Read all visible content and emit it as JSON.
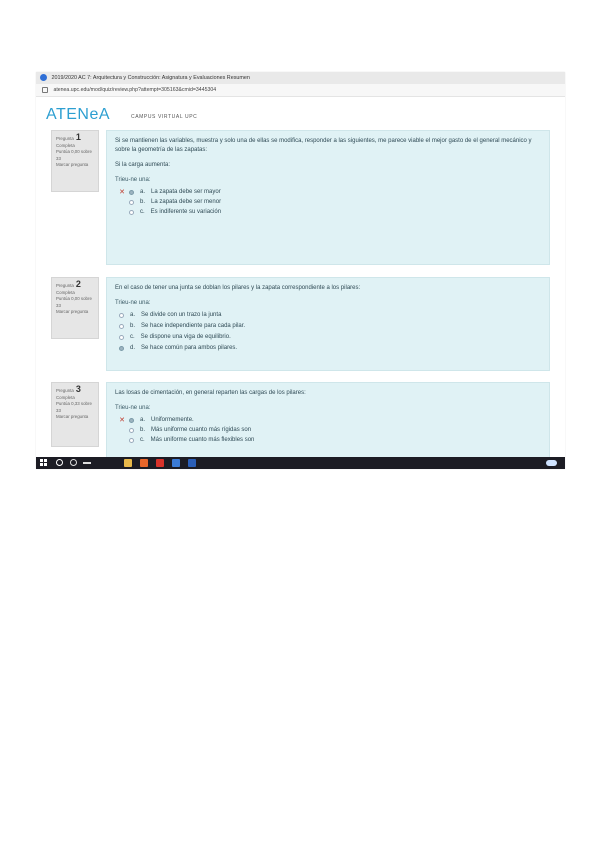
{
  "window": {
    "title": "2019/2020 AC 7: Arquitectura y Construcción: Asignatura y Evaluaciones Resumen",
    "url": "atenea.upc.edu/mod/quiz/review.php?attempt=305163&cmid=3445304"
  },
  "site": {
    "logo": "ATENeA",
    "subtitle": "CAMPUS VIRTUAL UPC"
  },
  "questions": [
    {
      "label": "Pregunta",
      "number": "1",
      "status": "Completa",
      "score": "Puntúa 0,00 sobre 33",
      "flag": "Marcar pregunta",
      "text": "Si se mantienen las variables, muestra y solo una de ellas se modifica, responder a las siguientes, me parece viable el mejor gasto de el general mecánico y sobre la geometría de las zapatas:",
      "subtext": "Si la carga aumenta:",
      "select_label": "Trieu-ne una:",
      "options": [
        {
          "letter": "a.",
          "text": "La zapata debe ser mayor",
          "state": "checked",
          "mark": "✕"
        },
        {
          "letter": "b.",
          "text": "La zapata debe ser menor",
          "state": "",
          "mark": ""
        },
        {
          "letter": "c.",
          "text": "Es indiferente su variación",
          "state": "",
          "mark": ""
        }
      ]
    },
    {
      "label": "Pregunta",
      "number": "2",
      "status": "Completa",
      "score": "Puntúa 0,00 sobre 33",
      "flag": "Marcar pregunta",
      "text": "En el caso de tener una junta se doblan los pilares y la zapata correspondiente a los pilares:",
      "subtext": "",
      "select_label": "Trieu-ne una:",
      "options": [
        {
          "letter": "a.",
          "text": "Se divide con un trazo la junta",
          "state": "",
          "mark": ""
        },
        {
          "letter": "b.",
          "text": "Se hace independiente para cada pilar.",
          "state": "",
          "mark": ""
        },
        {
          "letter": "c.",
          "text": "Se dispone una viga de equilibrio.",
          "state": "",
          "mark": ""
        },
        {
          "letter": "d.",
          "text": "Se hace común para ambos pilares.",
          "state": "checked",
          "mark": ""
        }
      ]
    },
    {
      "label": "Pregunta",
      "number": "3",
      "status": "Completa",
      "score": "Puntúa 0,33 sobre 33",
      "flag": "Marcar pregunta",
      "text": "Las losas de cimentación, en general reparten las cargas de los pilares:",
      "subtext": "",
      "select_label": "Trieu-ne una:",
      "options": [
        {
          "letter": "a.",
          "text": "Uniformemente.",
          "state": "checked",
          "mark": "✕"
        },
        {
          "letter": "b.",
          "text": "Más uniforme cuanto más rígidas son",
          "state": "",
          "mark": ""
        },
        {
          "letter": "c.",
          "text": "Más uniforme cuanto más flexibles son",
          "state": "",
          "mark": ""
        }
      ]
    }
  ],
  "colors": {
    "accent": "#2d9fd1",
    "question_bg": "#e0f2f5",
    "info_bg": "#e6e6e6",
    "taskbar": "#1c1c24"
  },
  "taskbar": {
    "icons": [
      "start-icon",
      "search-icon",
      "cortana-icon",
      "task-view-icon",
      "file-explorer-icon",
      "firefox-icon",
      "acrobat-icon",
      "app-icon",
      "word-icon",
      "onedrive-icon"
    ]
  }
}
